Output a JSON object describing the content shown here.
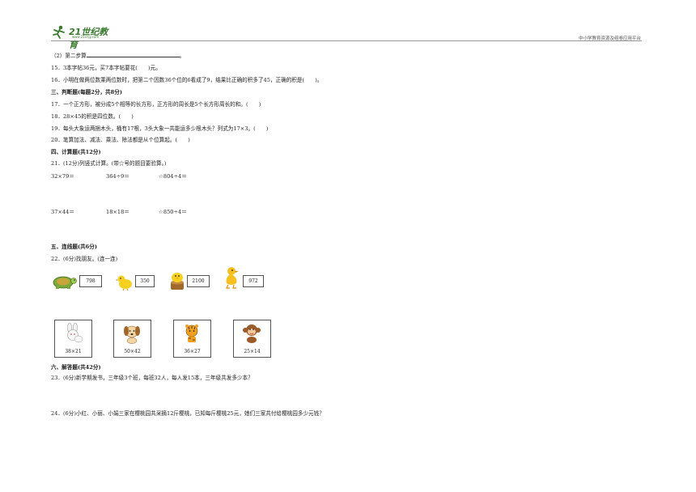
{
  "header": {
    "logo_text": "21世纪教育",
    "logo_sub": "www.21cnjy.com",
    "right_text": "中小学教育资源及组卷应用平台"
  },
  "lines": {
    "l1_prefix": "（2）第二步算",
    "l1_suffix": "。",
    "q15": "15．3本字帖36元，买7本字帖要花(　　)元。",
    "q16": "16．小明在做两位数乘两位数时，把第二个因数36个位的6看成了9，结果比正确的积多了45，正确的积是(　　)。",
    "sec3": "三、判断题(每题2分，共8分)",
    "q17": "17．一个正方形，被分成5个相等的长方形，正方形的周长是5个长方形周长的和。(　　)",
    "q18": "18．28×45的积是四位数。(　　)",
    "q19": "19．每头大象运两捆木头，桶有17根，3头大象一共能运多少根木头？列式为17×3。(　　)",
    "q20": "20．笔算加法、减法、乘法、除法都是从个位算起。(　　)",
    "sec4": "四、计算题(共12分)",
    "q21": "21．(12分)列竖式计算。(带☆号的题目要验算。)",
    "calc1": [
      "32×79＝",
      "364÷9＝",
      "☆804÷4＝"
    ],
    "calc2": [
      "37×44＝",
      "18×18＝",
      "☆850÷4＝"
    ],
    "sec5": "五、连线题(共6分)",
    "q22": "22．(6分)找朋友。(连一连)",
    "sec6": "六、解答题(共42分)",
    "q23": "23．(6分)新学期发书，三年级3个班，每班32人，每人发15本，三年级共发多少本？",
    "q24": "24．(6分)小红、小丽、小娟三家在樱桃园共采摘12斤樱桃，已知每斤樱桃25元，她们三家共付给樱桃园多少元钱？"
  },
  "matching": {
    "top_numbers": [
      "798",
      "350",
      "2100",
      "972"
    ],
    "top_animals": [
      "turtle-icon",
      "chick-icon",
      "chick-on-stump-icon",
      "duck-icon"
    ],
    "bottom_cards": [
      {
        "icon": "rabbit-icon",
        "label": "38×21"
      },
      {
        "icon": "dog-icon",
        "label": "50×42"
      },
      {
        "icon": "tiger-icon",
        "label": "36×27"
      },
      {
        "icon": "monkey-icon",
        "label": "25×14"
      }
    ]
  },
  "colors": {
    "logo_green": "#3a7a2e",
    "text": "#222222",
    "rule": "#999999"
  }
}
